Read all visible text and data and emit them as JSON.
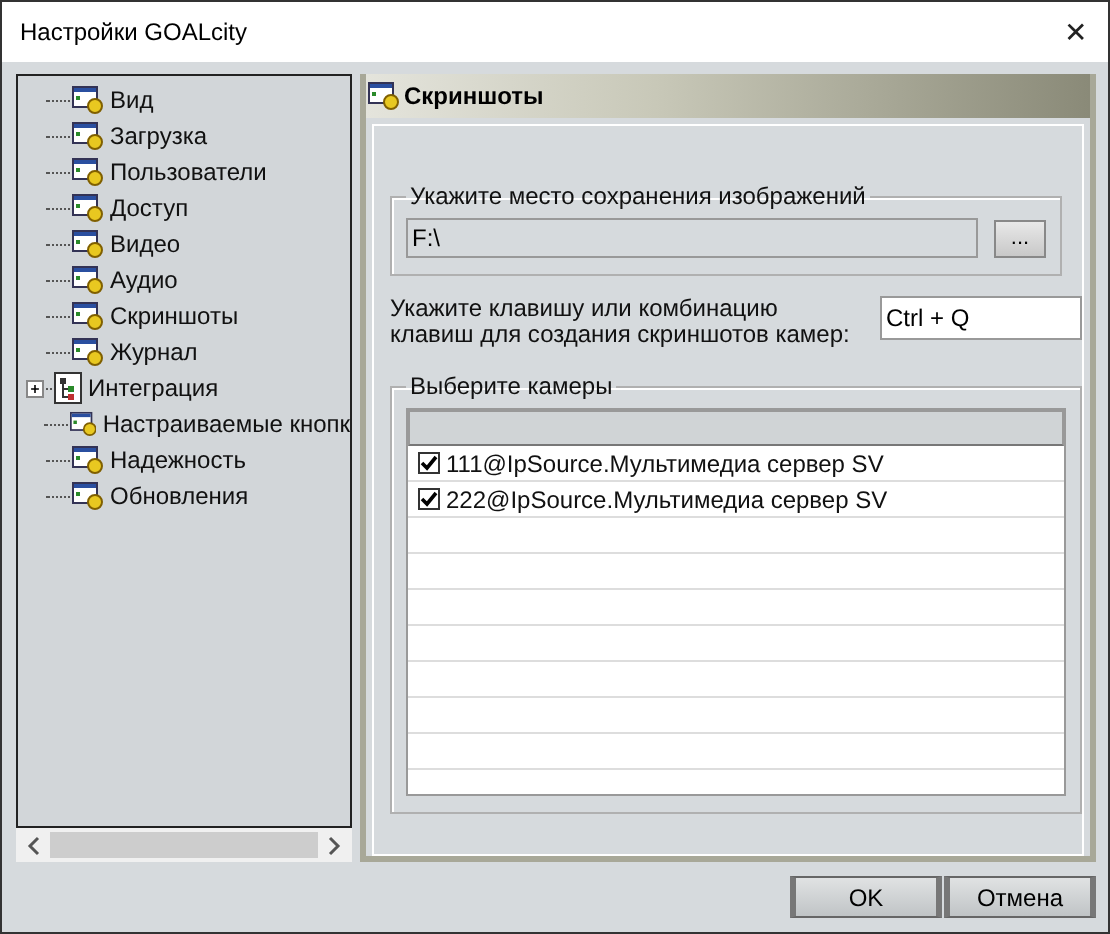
{
  "window": {
    "title": "Настройки GOALcity",
    "close": "✕"
  },
  "tree": [
    {
      "label": "Вид",
      "kind": "page"
    },
    {
      "label": "Загрузка",
      "kind": "page"
    },
    {
      "label": "Пользователи",
      "kind": "page"
    },
    {
      "label": "Доступ",
      "kind": "page"
    },
    {
      "label": "Видео",
      "kind": "page"
    },
    {
      "label": "Аудио",
      "kind": "page"
    },
    {
      "label": "Скриншоты",
      "kind": "page"
    },
    {
      "label": "Журнал",
      "kind": "page"
    },
    {
      "label": "Интеграция",
      "kind": "group",
      "expanded": false
    },
    {
      "label": "Настраиваемые кнопк",
      "kind": "page"
    },
    {
      "label": "Надежность",
      "kind": "page"
    },
    {
      "label": "Обновления",
      "kind": "page"
    }
  ],
  "panel": {
    "title": "Скриншоты",
    "save_group": {
      "legend": "Укажите место сохранения изображений",
      "path": "F:\\",
      "browse": "..."
    },
    "hotkey": {
      "label": "Укажите клавишу или комбинацию клавиш для создания скриншотов камер:",
      "value": "Ctrl + Q"
    },
    "cameras": {
      "legend": "Выберите камеры",
      "rows": [
        {
          "name": "111@IpSource.Мультимедиа сервер SV",
          "checked": true
        },
        {
          "name": "222@IpSource.Мультимедиа сервер SV",
          "checked": true
        }
      ]
    }
  },
  "buttons": [
    "OK",
    "Отмена"
  ]
}
